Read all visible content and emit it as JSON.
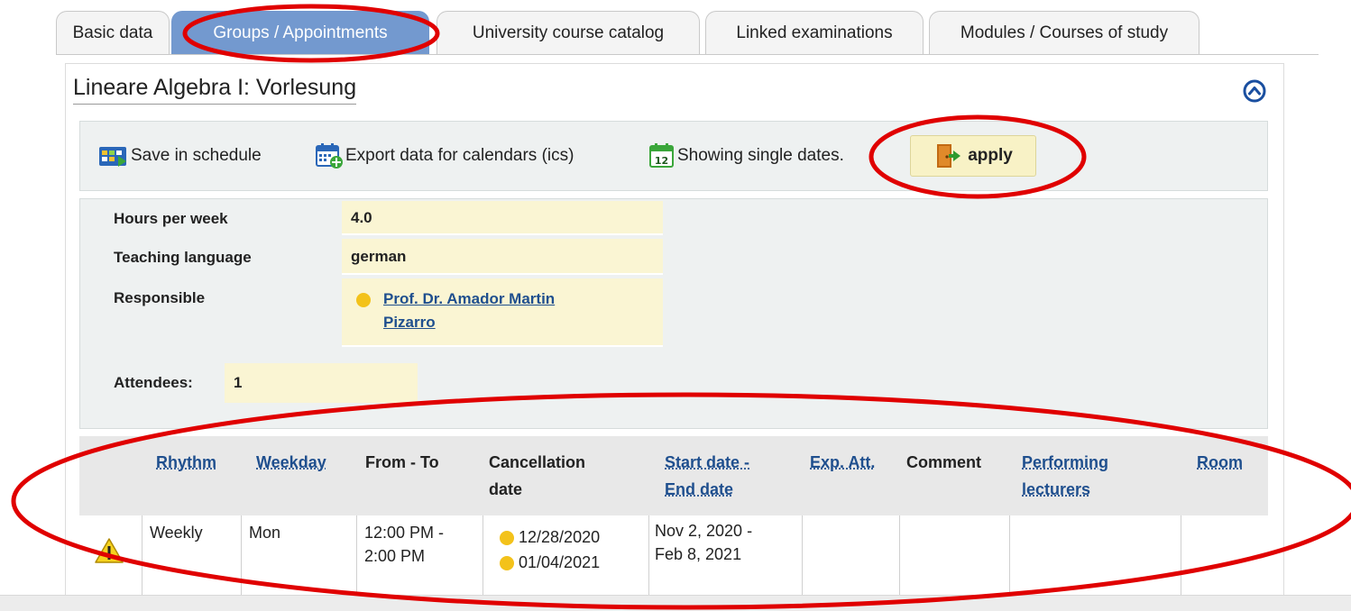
{
  "tabs": [
    "Basic data",
    "Groups / Appointments",
    "University course catalog",
    "Linked examinations",
    "Modules / Courses of study"
  ],
  "active_tab": "Groups / Appointments",
  "section": {
    "title": "Lineare Algebra I: Vorlesung",
    "collapse_icon": "collapse-up-icon"
  },
  "toolbar": {
    "save_schedule": "Save in schedule",
    "export_ics": "Export data for calendars (ics)",
    "single_dates": "Showing single dates.",
    "apply": "apply"
  },
  "details": {
    "hours_label": "Hours per week",
    "hours_value": "4.0",
    "language_label": "Teaching language",
    "language_value": "german",
    "responsible_label": "Responsible",
    "responsible_line1": "Prof. Dr. Amador Martin",
    "responsible_line2": "Pizarro",
    "attendees_label": "Attendees:",
    "attendees_value": "1"
  },
  "table": {
    "headers": {
      "rhythm": "Rhythm",
      "weekday": "Weekday",
      "from_to": "From - To",
      "cancel_1": "Cancellation",
      "cancel_2": "date",
      "start_1": "Start date -",
      "start_2": "End date",
      "exp_att": "Exp. Att.",
      "comment": "Comment",
      "lecturers_1": "Performing",
      "lecturers_2": "lecturers",
      "room": "Room"
    },
    "rows": [
      {
        "warning_icon": "warning-icon",
        "rhythm": "Weekly",
        "weekday": "Mon",
        "time_1": "12:00 PM -",
        "time_2": "2:00 PM",
        "cancel_1": "12/28/2020",
        "cancel_2": "01/04/2021",
        "dates_1": "Nov 2, 2020 -",
        "dates_2": "Feb 8, 2021",
        "exp_att": "",
        "comment": "",
        "lecturers": "",
        "room": ""
      }
    ]
  },
  "colors": {
    "active_tab": "#7399cf",
    "highlight_value": "#faf5d3",
    "annotation_red": "#e00000",
    "link": "#1f4f8e"
  }
}
